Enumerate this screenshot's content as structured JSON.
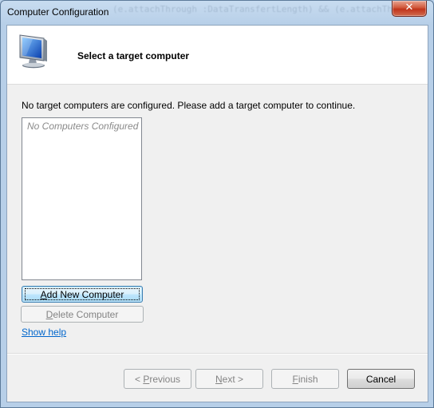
{
  "window": {
    "title": "Computer Configuration",
    "background_text": "(e.attachThrough :DataTransfertLength) && (e.attachThrough",
    "close_glyph": "✕"
  },
  "header": {
    "title": "Select a target computer",
    "icon": "computer-monitor-icon"
  },
  "body": {
    "instructions": "No target computers are configured. Please add a target computer to continue.",
    "list_empty_text": "No Computers Configured"
  },
  "buttons": {
    "add_new_computer": {
      "mnemonic": "A",
      "rest": "dd New Computer"
    },
    "delete_computer": {
      "mnemonic": "D",
      "rest": "elete Computer"
    },
    "previous": {
      "prefix": "< ",
      "mnemonic": "P",
      "rest": "revious"
    },
    "next": {
      "mnemonic": "N",
      "rest": "ext >"
    },
    "finish": {
      "mnemonic": "F",
      "rest": "inish"
    },
    "cancel": "Cancel"
  },
  "help_link": "Show help",
  "colors": {
    "link": "#0066cc",
    "disabled_text": "#838383",
    "close_button": "#c0341b"
  }
}
